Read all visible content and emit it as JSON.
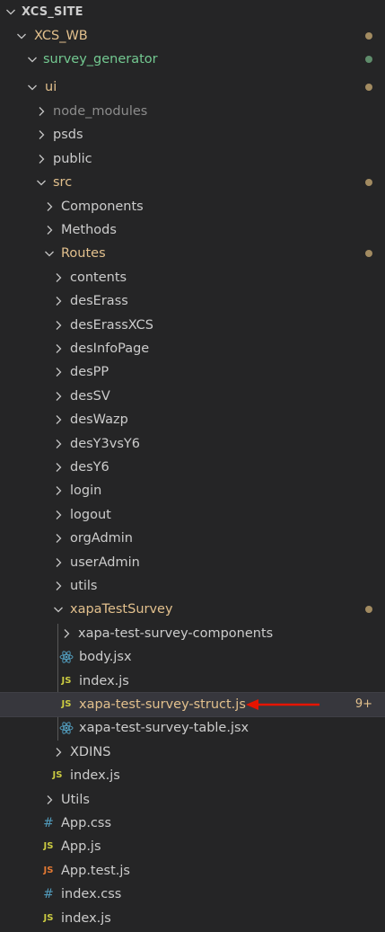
{
  "colors": {
    "background": "#252526",
    "modified": "#e2c08d",
    "untracked": "#73c991",
    "ignored": "#8c8c8c",
    "arrow": "#e51400"
  },
  "tree": {
    "root_label": "XCS_SITE",
    "items": [
      {
        "label": "XCS_WB",
        "state": "modified",
        "dot": true
      },
      {
        "label": "survey_generator",
        "state": "untracked",
        "dot": true
      },
      {
        "label": "ui",
        "state": "modified",
        "dot": true
      },
      {
        "label": "node_modules",
        "state": "ignored"
      },
      {
        "label": "psds"
      },
      {
        "label": "public"
      },
      {
        "label": "src",
        "state": "modified",
        "dot": true
      },
      {
        "label": "Components"
      },
      {
        "label": "Methods"
      },
      {
        "label": "Routes",
        "state": "modified",
        "dot": true
      },
      {
        "label": "contents"
      },
      {
        "label": "desErass"
      },
      {
        "label": "desErassXCS"
      },
      {
        "label": "desInfoPage"
      },
      {
        "label": "desPP"
      },
      {
        "label": "desSV"
      },
      {
        "label": "desWazp"
      },
      {
        "label": "desY3vsY6"
      },
      {
        "label": "desY6"
      },
      {
        "label": "login"
      },
      {
        "label": "logout"
      },
      {
        "label": "orgAdmin"
      },
      {
        "label": "userAdmin"
      },
      {
        "label": "utils"
      },
      {
        "label": "xapaTestSurvey",
        "state": "modified",
        "dot": true
      },
      {
        "label": "xapa-test-survey-components"
      },
      {
        "label": "body.jsx",
        "icon": "react-icon"
      },
      {
        "label": "index.js",
        "icon": "js-icon",
        "icon_text": "JS"
      },
      {
        "label": "xapa-test-survey-struct.js",
        "icon": "js-icon",
        "icon_text": "JS",
        "state": "modified",
        "badge": "9+"
      },
      {
        "label": "xapa-test-survey-table.jsx",
        "icon": "react-icon"
      },
      {
        "label": "XDINS"
      },
      {
        "label": "index.js",
        "icon": "js-icon",
        "icon_text": "JS"
      },
      {
        "label": "Utils"
      },
      {
        "label": "App.css",
        "icon": "css-icon",
        "icon_text": "#"
      },
      {
        "label": "App.js",
        "icon": "js-icon",
        "icon_text": "JS"
      },
      {
        "label": "App.test.js",
        "icon": "js-test-icon",
        "icon_text": "JS"
      },
      {
        "label": "index.css",
        "icon": "css-icon",
        "icon_text": "#"
      },
      {
        "label": "index.js",
        "icon": "js-icon",
        "icon_text": "JS"
      }
    ]
  }
}
